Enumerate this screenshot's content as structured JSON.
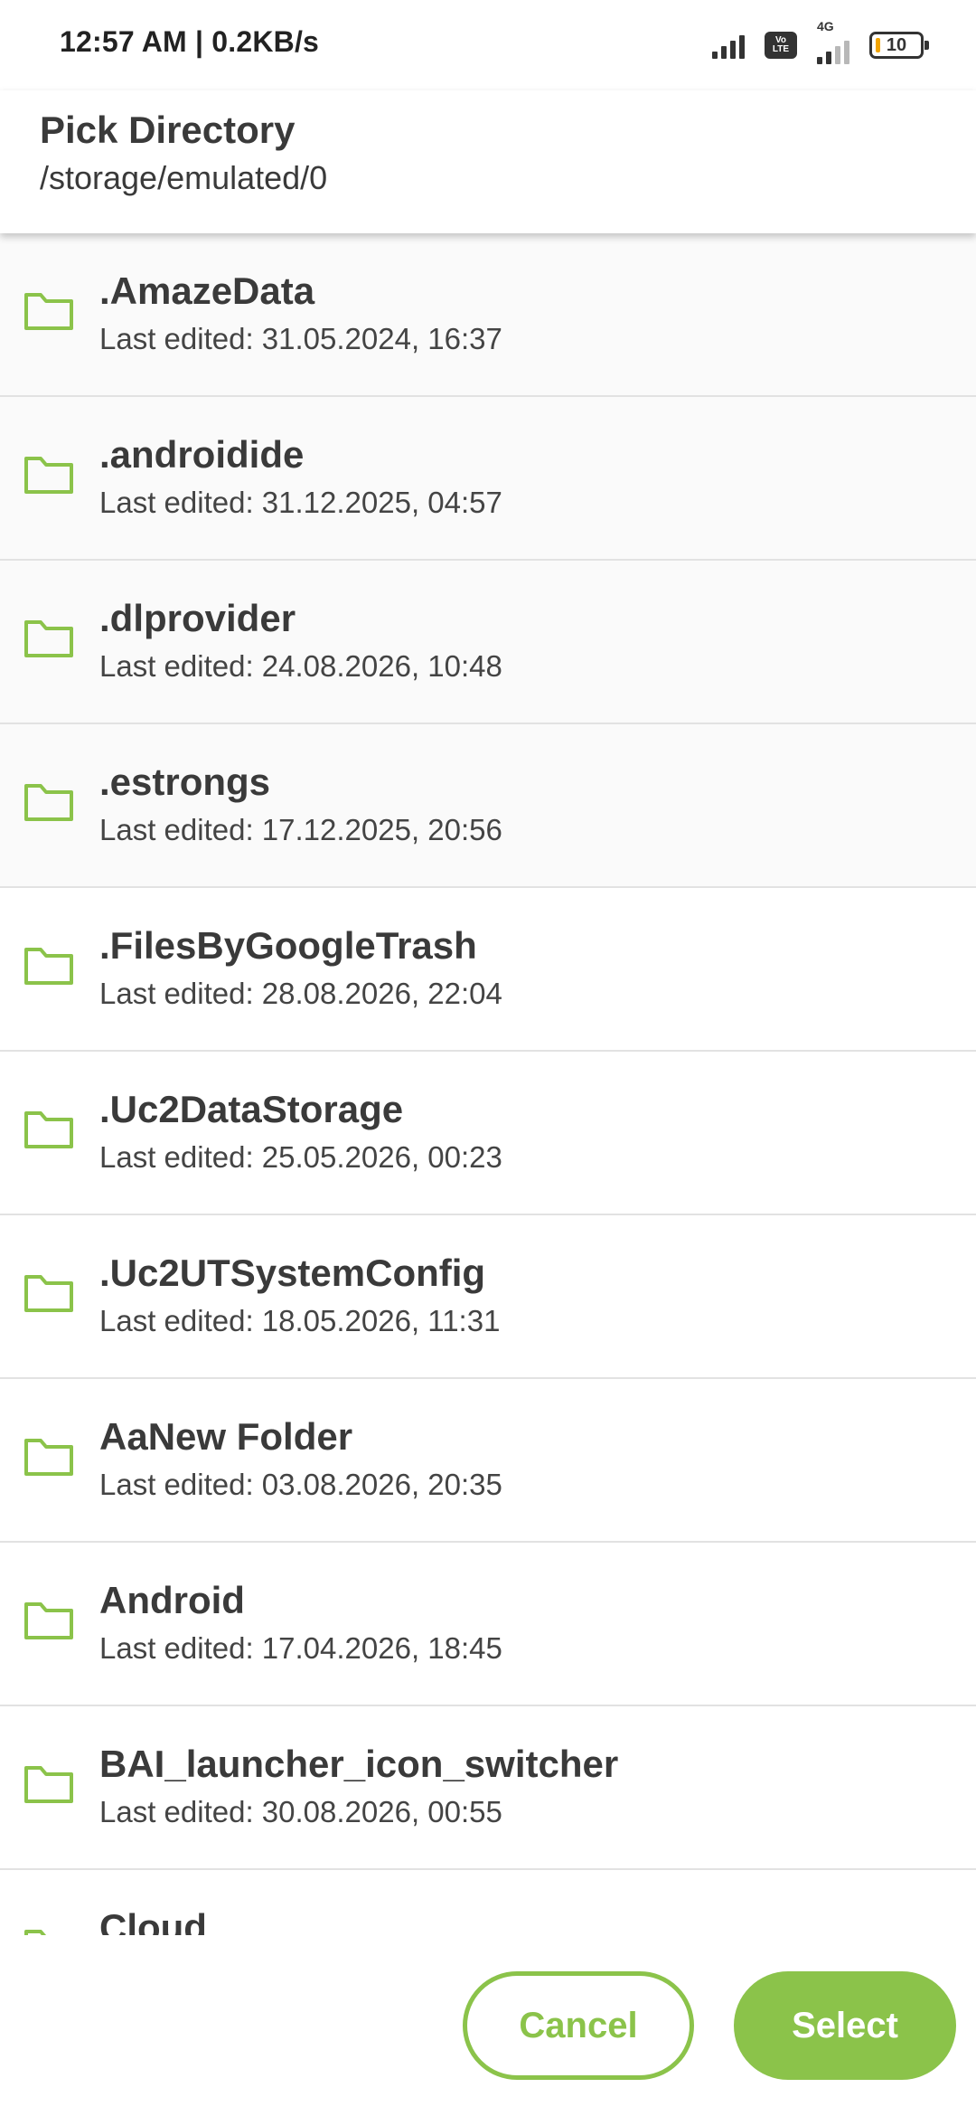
{
  "status_bar": {
    "time_speed": "12:57 AM | 0.2KB/s",
    "volte": "Vo LTE",
    "network": "4G",
    "battery": "10"
  },
  "header": {
    "title": "Pick Directory",
    "path": "/storage/emulated/0"
  },
  "folders": [
    {
      "name": ".AmazeData",
      "meta": "Last edited: 31.05.2024, 16:37"
    },
    {
      "name": ".androidide",
      "meta": "Last edited: 31.12.2025, 04:57"
    },
    {
      "name": ".dlprovider",
      "meta": "Last edited: 24.08.2026, 10:48"
    },
    {
      "name": ".estrongs",
      "meta": "Last edited: 17.12.2025, 20:56"
    },
    {
      "name": ".FilesByGoogleTrash",
      "meta": "Last edited: 28.08.2026, 22:04"
    },
    {
      "name": ".Uc2DataStorage",
      "meta": "Last edited: 25.05.2026, 00:23"
    },
    {
      "name": ".Uc2UTSystemConfig",
      "meta": "Last edited: 18.05.2026, 11:31"
    },
    {
      "name": "AaNew Folder",
      "meta": "Last edited: 03.08.2026, 20:35"
    },
    {
      "name": "Android",
      "meta": "Last edited: 17.04.2026, 18:45"
    },
    {
      "name": "BAI_launcher_icon_switcher",
      "meta": "Last edited: 30.08.2026, 00:55"
    },
    {
      "name": "Cloud",
      "meta": ""
    }
  ],
  "buttons": {
    "cancel": "Cancel",
    "select": "Select"
  },
  "colors": {
    "accent": "#8bc34a"
  },
  "icons": {
    "folder": "folder-icon"
  }
}
